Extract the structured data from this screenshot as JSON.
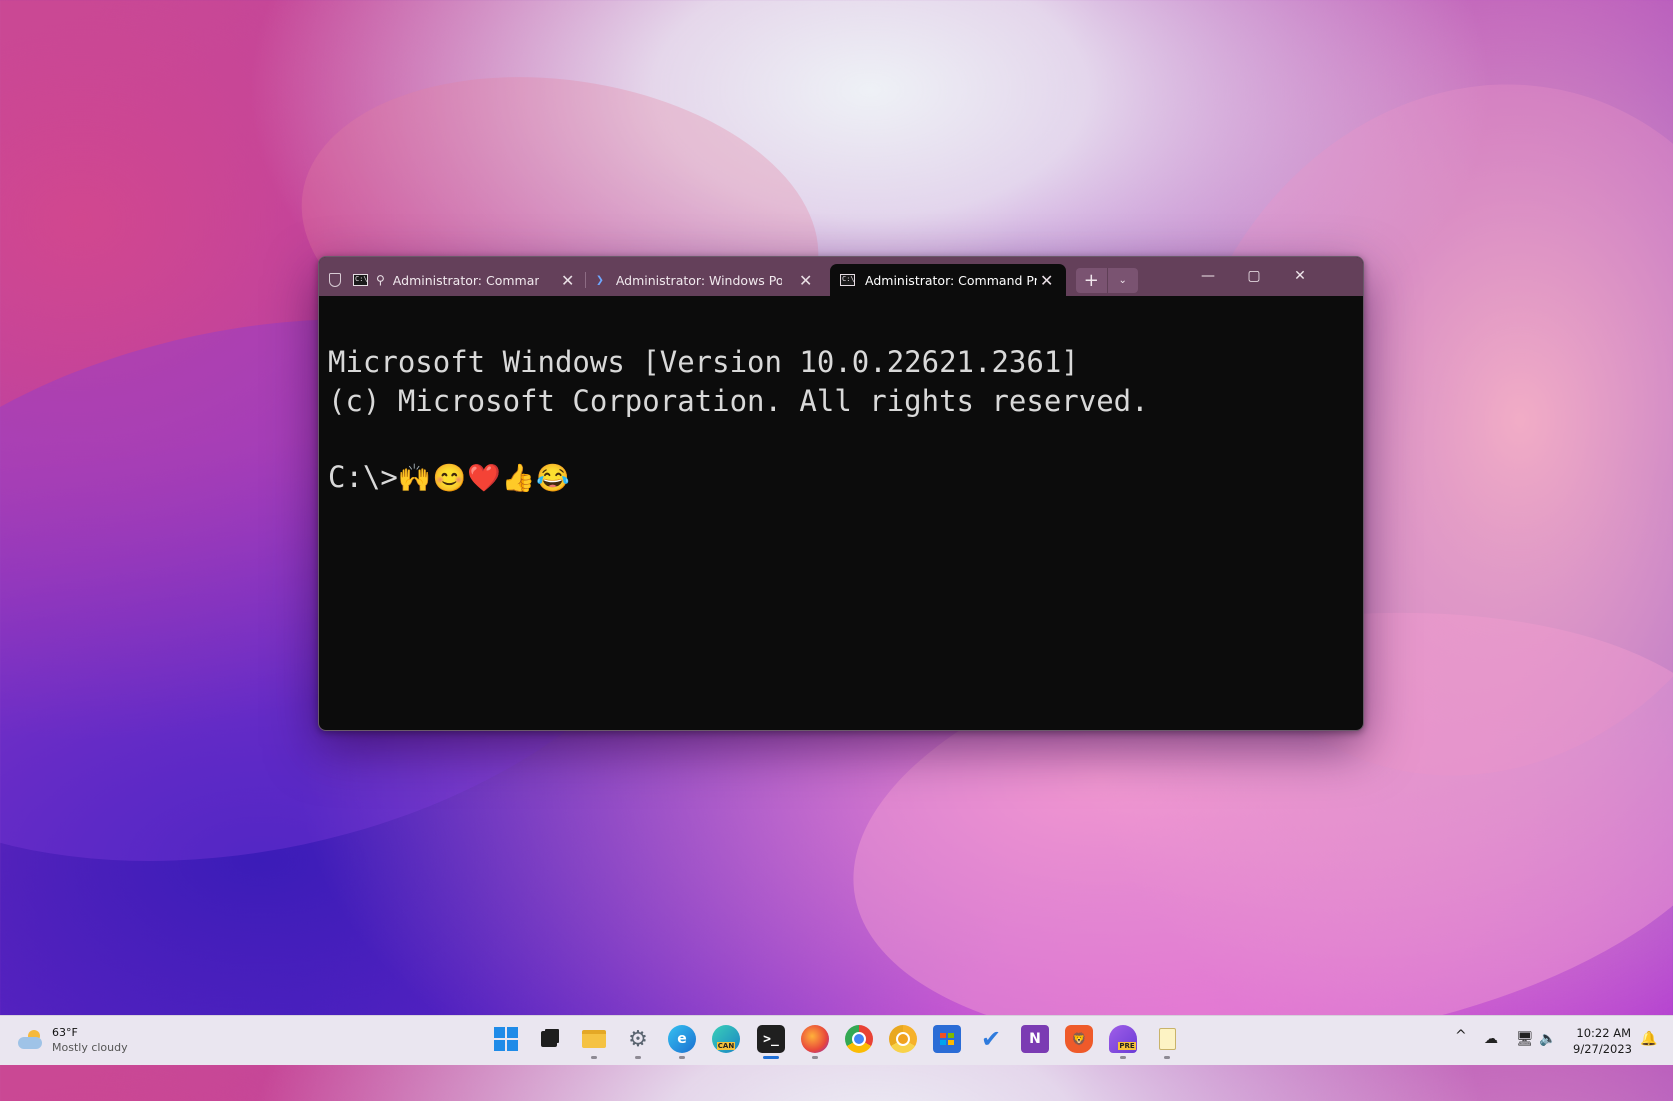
{
  "terminal": {
    "tabs": [
      {
        "label": "Administrator: Command P",
        "icon": "cmd-icon",
        "active": false
      },
      {
        "label": "Administrator: Windows Power",
        "icon": "powershell-icon",
        "active": false
      },
      {
        "label": "Administrator: Command Pro",
        "icon": "cmd-icon",
        "active": true
      }
    ],
    "new_tab_symbol": "+",
    "dropdown_symbol": "⌄",
    "minimize_symbol": "—",
    "maximize_symbol": "▢",
    "close_symbol": "✕",
    "tab_close_symbol": "✕",
    "console_lines": [
      "Microsoft Windows [Version 10.0.22621.2361]",
      "(c) Microsoft Corporation. All rights reserved."
    ],
    "prompt": "C:\\>",
    "prompt_input": "🙌😊❤️👍😂"
  },
  "taskbar": {
    "weather": {
      "temperature": "63°F",
      "condition": "Mostly cloudy"
    },
    "apps": [
      {
        "name": "start",
        "icon": "windows-start-icon"
      },
      {
        "name": "task-view",
        "icon": "task-view-icon"
      },
      {
        "name": "file-explorer",
        "icon": "folder-icon"
      },
      {
        "name": "settings",
        "icon": "gear-icon"
      },
      {
        "name": "edge",
        "icon": "edge-icon"
      },
      {
        "name": "edge-canary",
        "icon": "edge-canary-icon",
        "badge": "CAN"
      },
      {
        "name": "terminal",
        "icon": "terminal-icon",
        "active": true
      },
      {
        "name": "firefox",
        "icon": "firefox-icon"
      },
      {
        "name": "chrome",
        "icon": "chrome-icon"
      },
      {
        "name": "chrome-canary",
        "icon": "chrome-canary-icon"
      },
      {
        "name": "store",
        "icon": "store-icon"
      },
      {
        "name": "todo",
        "icon": "checkmark-icon"
      },
      {
        "name": "onenote",
        "icon": "onenote-icon",
        "letter": "N"
      },
      {
        "name": "brave",
        "icon": "brave-icon"
      },
      {
        "name": "dev-home",
        "icon": "dev-home-icon",
        "badge": "PRE"
      },
      {
        "name": "notepad",
        "icon": "notepad-icon"
      }
    ],
    "tray": {
      "chevron": "^",
      "time": "10:22 AM",
      "date": "9/27/2023"
    }
  },
  "colors": {
    "titlebar": "#64405a",
    "console_bg": "#0c0c0c",
    "console_fg": "#d9d9d9",
    "taskbar_bg": "#eae6f0",
    "accent": "#1f6fd6"
  }
}
